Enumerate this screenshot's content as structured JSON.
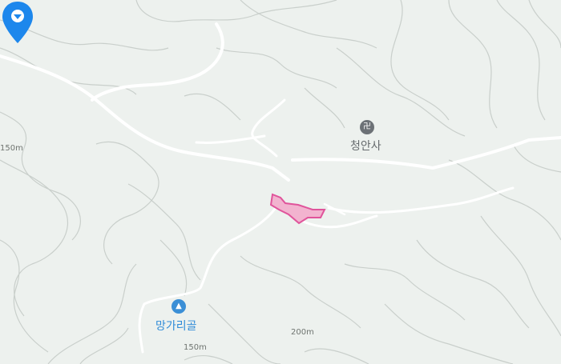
{
  "map": {
    "places": [
      {
        "name": "청안사",
        "icon": "temple-icon",
        "color": "#6c7176"
      },
      {
        "name": "망가리골",
        "icon": "mountain-valley-icon",
        "color": "#3b8fd6"
      }
    ],
    "elevation_labels": [
      "150m",
      "200m",
      "150m"
    ],
    "colors": {
      "background": "#edf1ee",
      "contour": "#c9cfcb",
      "road": "#ffffff",
      "pin": "#1d87ec",
      "highlight_fill": "#f2b3cf",
      "highlight_stroke": "#e0549b"
    }
  }
}
